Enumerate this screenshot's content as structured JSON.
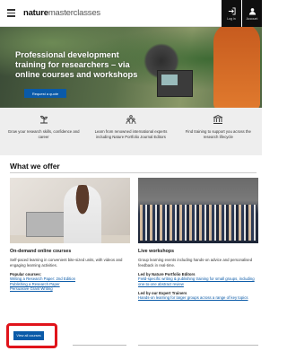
{
  "header": {
    "brand_bold": "nature",
    "brand_light": "masterclasses",
    "actions": [
      {
        "label": "Log in",
        "icon": "login-icon"
      },
      {
        "label": "Account",
        "icon": "user-icon"
      }
    ]
  },
  "hero": {
    "title": "Professional development training for researchers – via online courses and workshops",
    "button_label": "Request a quote"
  },
  "features": [
    {
      "icon": "growth-icon",
      "text": "Grow your research skills, confidence and career"
    },
    {
      "icon": "people-icon",
      "text": "Learn from renowned international experts including Nature Portfolio Journal Editors"
    },
    {
      "icon": "institution-icon",
      "text": "Find training to support you across the research lifecycle"
    }
  ],
  "offer": {
    "title": "What we offer",
    "online": {
      "title": "On-demand online courses",
      "description": "Self-paced learning in convenient bite-sized units, with videos and engaging learning activities.",
      "popular_heading": "Popular courses:",
      "courses": [
        "Writing a Research Paper: 2nd Edition",
        "Publishing a Research Paper",
        "Persuasive Grant Writing"
      ],
      "button_label": "View all courses"
    },
    "live": {
      "title": "Live workshops",
      "description": "Group learning events including hands-on advice and personalised feedback in real-time.",
      "editors_heading": "Led by Nature Portfolio Editors",
      "editors_link": "Field-specific writing & publishing training for small groups, including one-to-one abstract review",
      "trainers_heading": "Led by our Expert Trainers",
      "trainers_link": "Hands-on learning for larger groups across a range of key topics"
    }
  },
  "colors": {
    "brand_blue": "#0a5aa8",
    "highlight_red": "#e0141b",
    "header_button": "#0f0f0f"
  }
}
